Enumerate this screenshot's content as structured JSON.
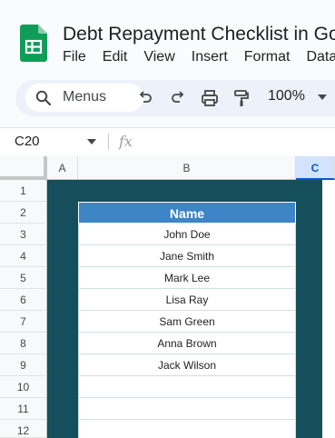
{
  "app": {
    "title": "Debt Repayment Checklist  in Go",
    "menu": [
      "File",
      "Edit",
      "View",
      "Insert",
      "Format",
      "Data"
    ]
  },
  "toolbar": {
    "search_label": "Menus",
    "zoom": "100%"
  },
  "formula_bar": {
    "name_box": "C20",
    "fx_label": "fx"
  },
  "grid": {
    "columns": [
      "A",
      "B",
      "C"
    ],
    "selected_column": "C",
    "rows": [
      "1",
      "2",
      "3",
      "4",
      "5",
      "6",
      "7",
      "8",
      "9",
      "10",
      "11",
      "12"
    ]
  },
  "table": {
    "header": "Name",
    "names": [
      "John Doe",
      "Jane Smith",
      "Mark Lee",
      "Lisa Ray",
      "Sam Green",
      "Anna Brown",
      "Jack Wilson",
      "",
      "",
      ""
    ]
  },
  "colors": {
    "sheets_green": "#0f9d58",
    "teal_background": "#144f5b",
    "table_header_blue": "#3d85c6",
    "selected_header": "#d3e3fd"
  }
}
